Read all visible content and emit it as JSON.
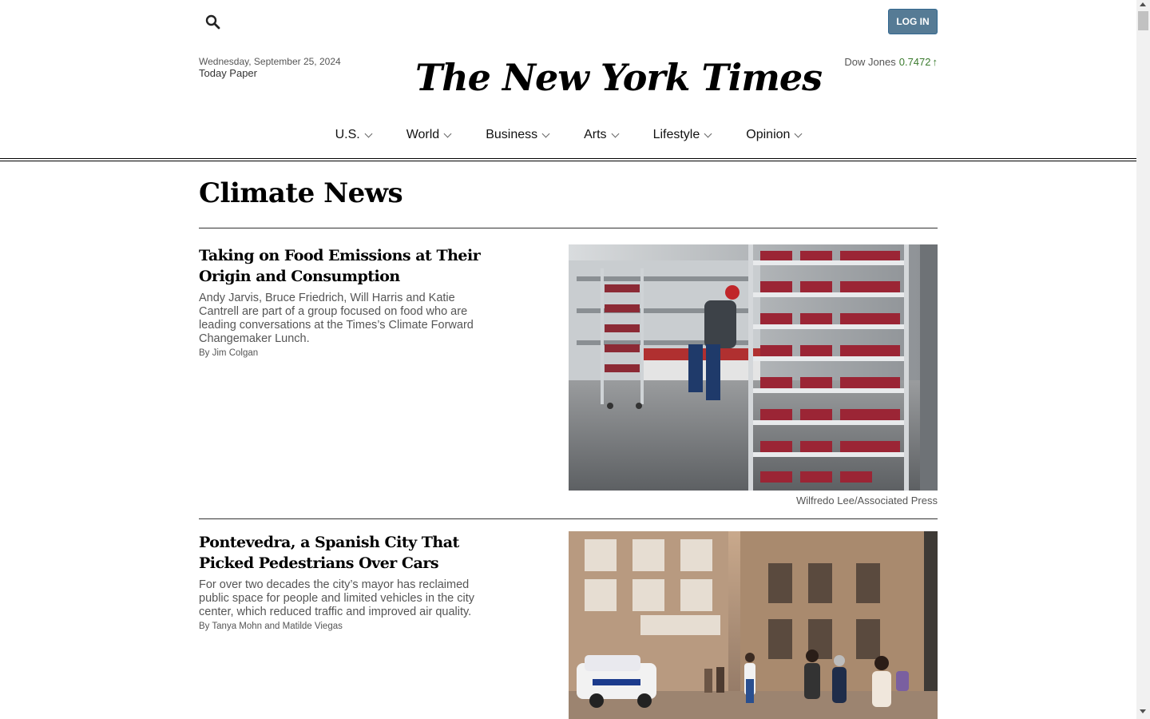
{
  "header": {
    "login_label": "LOG IN",
    "date": "Wednesday, September 25, 2024",
    "today_paper": "Today Paper",
    "logo_text": "The New York Times",
    "market_label": "Dow Jones",
    "market_value": "0.7472",
    "market_arrow": "↑"
  },
  "nav": {
    "items": [
      {
        "label": "U.S."
      },
      {
        "label": "World"
      },
      {
        "label": "Business"
      },
      {
        "label": "Arts"
      },
      {
        "label": "Lifestyle"
      },
      {
        "label": "Opinion"
      }
    ]
  },
  "section": {
    "title": "Climate News"
  },
  "stories": [
    {
      "headline": "Taking on Food Emissions at Their Origin and Consumption",
      "summary": "Andy Jarvis, Bruce Friedrich, Will Harris and Katie Cantrell are part of a group focused on food who are leading conversations at the Times’s Climate Forward Changemaker Lunch.",
      "byline": "By Jim Colgan",
      "credit": "Wilfredo Lee/Associated Press"
    },
    {
      "headline": "Pontevedra, a Spanish City That Picked Pedestrians Over Cars",
      "summary": "For over two decades the city’s mayor has reclaimed public space for people and limited vehicles in the city center, which reduced traffic and improved air quality.",
      "byline": "By Tanya Mohn and Matilde Viegas"
    }
  ],
  "colors": {
    "login_bg": "#567b95",
    "market_up": "#3b7b2e",
    "text": "#121212"
  }
}
